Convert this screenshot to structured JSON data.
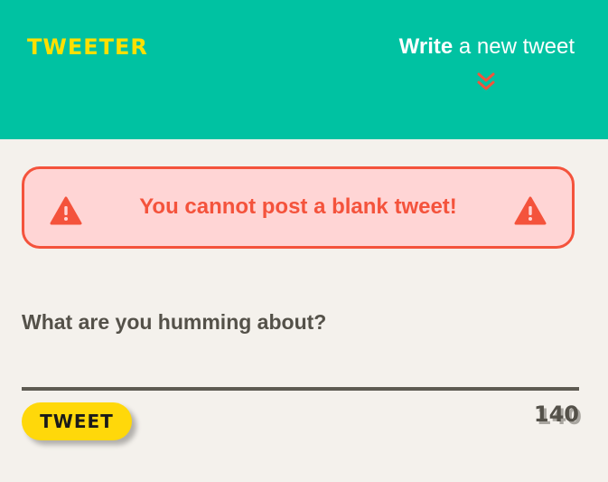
{
  "header": {
    "logo": "TWEETER",
    "compose_bold": "Write",
    "compose_rest": " a new tweet",
    "chevron_icon": "double-chevron-down-icon",
    "background": "#00c2a2",
    "logo_color": "#ffe000"
  },
  "alert": {
    "message": "You cannot post a blank tweet!",
    "icon": "warning-icon",
    "color": "#f4533c",
    "background": "#ffd5d5"
  },
  "compose": {
    "label": "What are you humming about?",
    "value": "",
    "button_label": "TWEET",
    "char_count": "140",
    "button_color": "#ffd80a"
  }
}
